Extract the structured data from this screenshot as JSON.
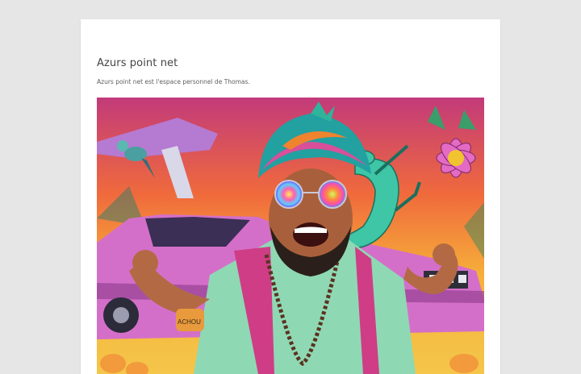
{
  "site": {
    "title": "Azurs point net",
    "description": "Azurs point net est l'espace personnel de Thomas."
  },
  "header_image": {
    "alt": "",
    "sign_text": "ACHOU"
  },
  "colors": {
    "background": "#e6e6e6",
    "page": "#ffffff",
    "title": "#444444",
    "description": "#5e5e5e"
  }
}
